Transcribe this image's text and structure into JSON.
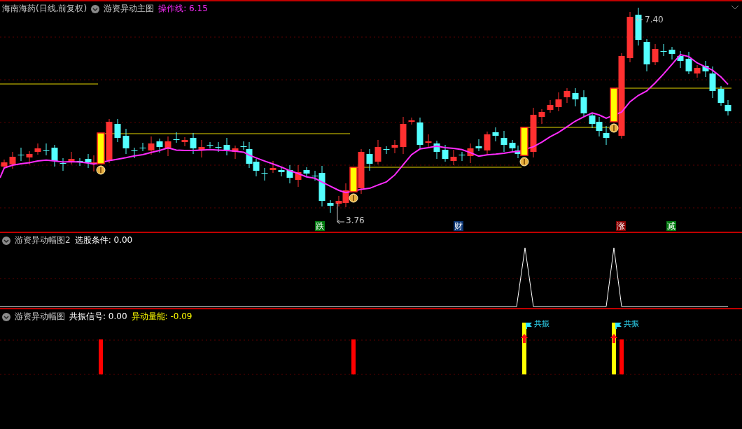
{
  "main_pane": {
    "stock": "海南海药(日线,前复权)",
    "indicator": "游资异动主图",
    "line_label": "操作线:",
    "line_value": "6.15",
    "high_label": "7.40",
    "low_label": "3.76",
    "signals": [
      {
        "text": "跌",
        "color": "#007a10"
      },
      {
        "text": "财",
        "color": "#0a3574"
      },
      {
        "text": "涨",
        "color": "#850000"
      },
      {
        "text": "减",
        "color": "#007a10"
      }
    ]
  },
  "pane_2": {
    "indicator": "游资异动幅图2",
    "fields": [
      {
        "label": "选股条件:",
        "value": "0.00",
        "color": "#ffffff"
      }
    ]
  },
  "pane_3": {
    "indicator": "游资异动幅图",
    "fields": [
      {
        "label": "共振信号:",
        "value": "0.00",
        "color": "#ffffff"
      },
      {
        "label": "异动量能:",
        "value": "-0.09",
        "color": "#ffff00"
      }
    ],
    "markers": [
      {
        "text": "共振"
      },
      {
        "text": "共振"
      }
    ]
  }
}
